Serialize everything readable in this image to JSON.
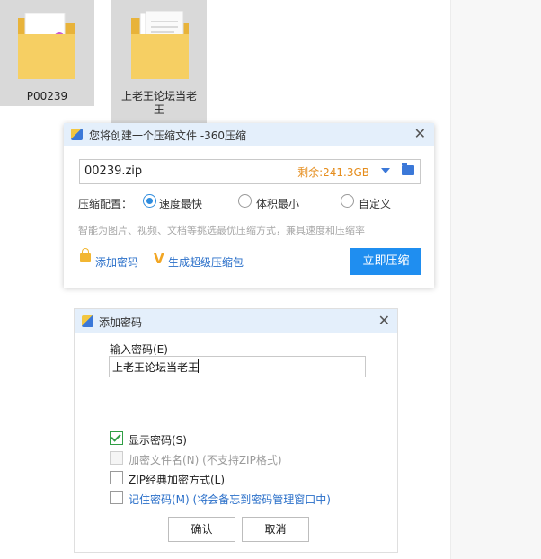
{
  "desktop": {
    "icons": [
      {
        "label": "P00239"
      },
      {
        "label_line1": "上老王论坛当老",
        "label_line2": "王"
      }
    ]
  },
  "compress_dialog": {
    "title": "您将创建一个压缩文件 -360压缩",
    "close": "✕",
    "filename": "00239.zip",
    "free_space": "剩余:241.3GB",
    "config_label": "压缩配置：",
    "options": [
      "速度最快",
      "体积最小",
      "自定义"
    ],
    "selected_option": "速度最快",
    "hint": "智能为图片、视频、文档等挑选最优压缩方式，兼具速度和压缩率",
    "add_password": "添加密码",
    "super_package": "生成超级压缩包",
    "compress_now": "立即压缩"
  },
  "password_dialog": {
    "title": "添加密码",
    "close": "✕",
    "input_label": "输入密码(E)",
    "password_value": "上老王论坛当老王",
    "checkboxes": [
      {
        "label": "显示密码(S)",
        "note": "",
        "checked": true,
        "enabled": true
      },
      {
        "label": "加密文件名(N)",
        "note": " (不支持ZIP格式)",
        "checked": false,
        "enabled": false
      },
      {
        "label": "ZIP经典加密方式(L)",
        "note": "",
        "checked": false,
        "enabled": true
      },
      {
        "label": "记住密码(M)",
        "note": " (将会备忘到密码管理窗口中)",
        "checked": false,
        "enabled": true
      }
    ],
    "ok": "确认",
    "cancel": "取消"
  },
  "colors": {
    "accent": "#1f8ef0",
    "link": "#2a6fc9",
    "space_text": "#e58c1b",
    "titlebar": "#e4effb"
  }
}
